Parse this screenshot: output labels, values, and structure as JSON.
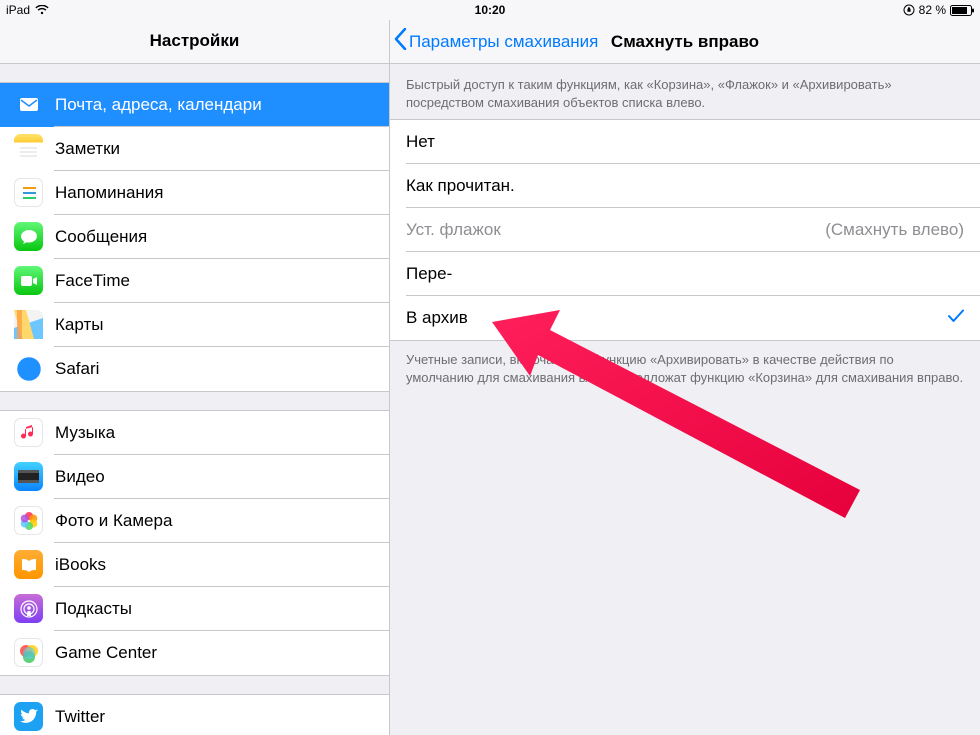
{
  "status": {
    "device": "iPad",
    "time": "10:20",
    "battery": "82 %"
  },
  "sidebar": {
    "title": "Настройки",
    "groups": [
      {
        "items": [
          {
            "id": "mail",
            "label": "Почта, адреса, календари",
            "selected": true
          },
          {
            "id": "notes",
            "label": "Заметки"
          },
          {
            "id": "reminders",
            "label": "Напоминания"
          },
          {
            "id": "messages",
            "label": "Сообщения"
          },
          {
            "id": "facetime",
            "label": "FaceTime"
          },
          {
            "id": "maps",
            "label": "Карты"
          },
          {
            "id": "safari",
            "label": "Safari"
          }
        ]
      },
      {
        "items": [
          {
            "id": "music",
            "label": "Музыка"
          },
          {
            "id": "videos",
            "label": "Видео"
          },
          {
            "id": "photos",
            "label": "Фото и Камера"
          },
          {
            "id": "ibooks",
            "label": "iBooks"
          },
          {
            "id": "podcasts",
            "label": "Подкасты"
          },
          {
            "id": "gamecenter",
            "label": "Game Center"
          }
        ]
      },
      {
        "items": [
          {
            "id": "twitter",
            "label": "Twitter"
          }
        ]
      }
    ]
  },
  "detail": {
    "back": "Параметры смахивания",
    "title": "Смахнуть вправо",
    "description": "Быстрый доступ к таким функциям, как «Корзина», «Флажок» и «Архивировать» посредством смахивания объектов списка влево.",
    "options": [
      {
        "label": "Нет"
      },
      {
        "label": "Как прочитан."
      },
      {
        "label": "Уст. флажок",
        "disabled": true,
        "right": "(Смахнуть влево)"
      },
      {
        "label": "Пере-"
      },
      {
        "label": "В архив",
        "checked": true
      }
    ],
    "footer": "Учетные записи, включающие функцию «Архивировать» в качестве действия по умолчанию для смахивания влево, предложат функцию «Корзина» для смахивания вправо."
  }
}
